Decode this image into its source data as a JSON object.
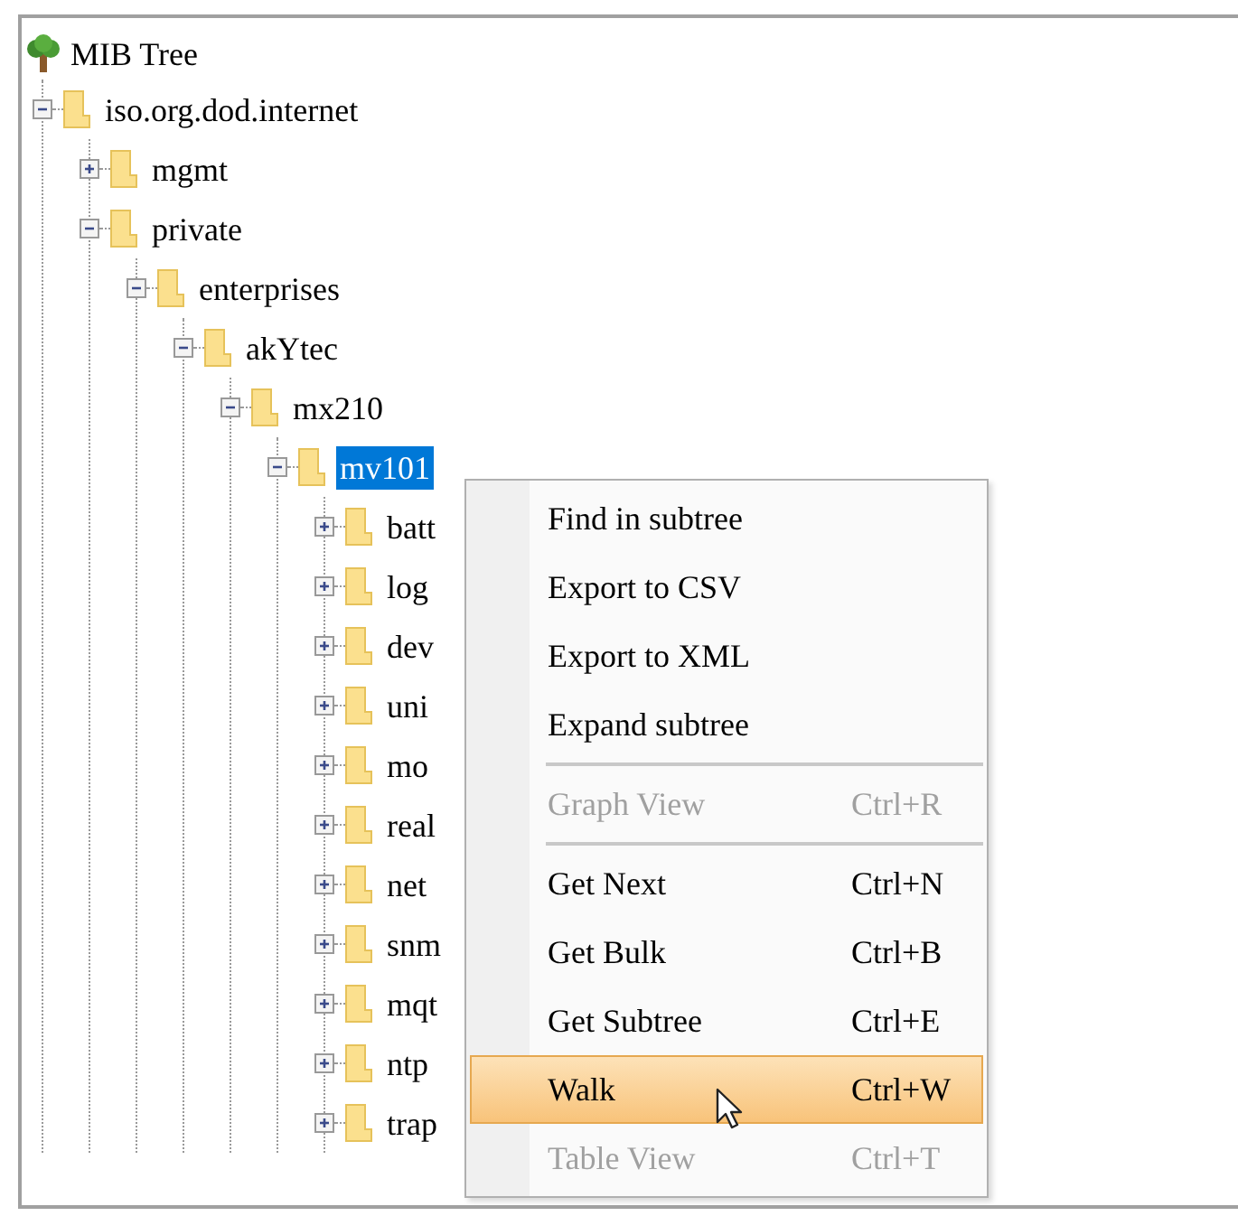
{
  "tree": {
    "title": "MIB Tree",
    "nodes": [
      {
        "label": "iso.org.dod.internet",
        "expanded": true,
        "selected": false,
        "children": [
          {
            "label": "mgmt",
            "expanded": false,
            "selected": false
          },
          {
            "label": "private",
            "expanded": true,
            "selected": false,
            "children": [
              {
                "label": "enterprises",
                "expanded": true,
                "selected": false,
                "children": [
                  {
                    "label": "akYtec",
                    "expanded": true,
                    "selected": false,
                    "children": [
                      {
                        "label": "mx210",
                        "expanded": true,
                        "selected": false,
                        "children": [
                          {
                            "label": "mv101",
                            "expanded": true,
                            "selected": true,
                            "children": [
                              {
                                "label": "batt",
                                "expanded": false,
                                "selected": false
                              },
                              {
                                "label": "log",
                                "expanded": false,
                                "selected": false
                              },
                              {
                                "label": "dev",
                                "expanded": false,
                                "selected": false
                              },
                              {
                                "label": "uni",
                                "expanded": false,
                                "selected": false
                              },
                              {
                                "label": "mo",
                                "expanded": false,
                                "selected": false
                              },
                              {
                                "label": "real",
                                "expanded": false,
                                "selected": false
                              },
                              {
                                "label": "net",
                                "expanded": false,
                                "selected": false
                              },
                              {
                                "label": "snm",
                                "expanded": false,
                                "selected": false
                              },
                              {
                                "label": "mqt",
                                "expanded": false,
                                "selected": false
                              },
                              {
                                "label": "ntp",
                                "expanded": false,
                                "selected": false
                              },
                              {
                                "label": "trap",
                                "expanded": false,
                                "selected": false
                              }
                            ]
                          }
                        ]
                      }
                    ]
                  }
                ]
              }
            ]
          }
        ]
      }
    ]
  },
  "context_menu": {
    "items": [
      {
        "kind": "item",
        "label": "Find in subtree",
        "disabled": false,
        "selected": false
      },
      {
        "kind": "item",
        "label": "Export to CSV",
        "disabled": false,
        "selected": false
      },
      {
        "kind": "item",
        "label": "Export to XML",
        "disabled": false,
        "selected": false
      },
      {
        "kind": "item",
        "label": "Expand subtree",
        "disabled": false,
        "selected": false
      },
      {
        "kind": "separator"
      },
      {
        "kind": "item",
        "label": "Graph View",
        "shortcut": "Ctrl+R",
        "disabled": true,
        "selected": false
      },
      {
        "kind": "separator"
      },
      {
        "kind": "item",
        "label": "Get Next",
        "shortcut": "Ctrl+N",
        "disabled": false,
        "selected": false
      },
      {
        "kind": "item",
        "label": "Get Bulk",
        "shortcut": "Ctrl+B",
        "disabled": false,
        "selected": false
      },
      {
        "kind": "item",
        "label": "Get Subtree",
        "shortcut": "Ctrl+E",
        "disabled": false,
        "selected": false
      },
      {
        "kind": "item",
        "label": "Walk",
        "shortcut": "Ctrl+W",
        "disabled": false,
        "selected": true
      },
      {
        "kind": "item",
        "label": "Table View",
        "shortcut": "Ctrl+T",
        "disabled": true,
        "selected": false
      }
    ]
  }
}
